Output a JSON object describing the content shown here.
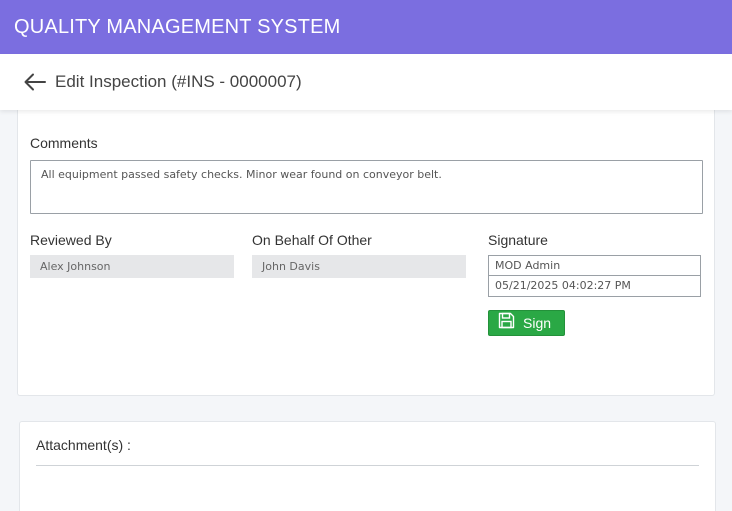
{
  "app": {
    "title": "QUALITY MANAGEMENT SYSTEM",
    "bar_color": "#7b6ee0"
  },
  "header": {
    "back_icon": "arrow-left-icon",
    "title": "Edit Inspection (#INS - 0000007)"
  },
  "form": {
    "comments": {
      "label": "Comments",
      "value": "All equipment passed safety checks. Minor wear found on conveyor belt."
    },
    "reviewed_by": {
      "label": "Reviewed By",
      "value": "Alex Johnson"
    },
    "on_behalf_of_other": {
      "label": "On Behalf Of Other",
      "value": "John Davis"
    },
    "signature": {
      "label": "Signature",
      "signer": "MOD Admin",
      "timestamp": "05/21/2025 04:02:27 PM",
      "sign_button_label": "Sign",
      "sign_button_icon": "save-icon",
      "sign_button_color": "#2aa845"
    }
  },
  "attachments": {
    "label": "Attachment(s) :"
  }
}
